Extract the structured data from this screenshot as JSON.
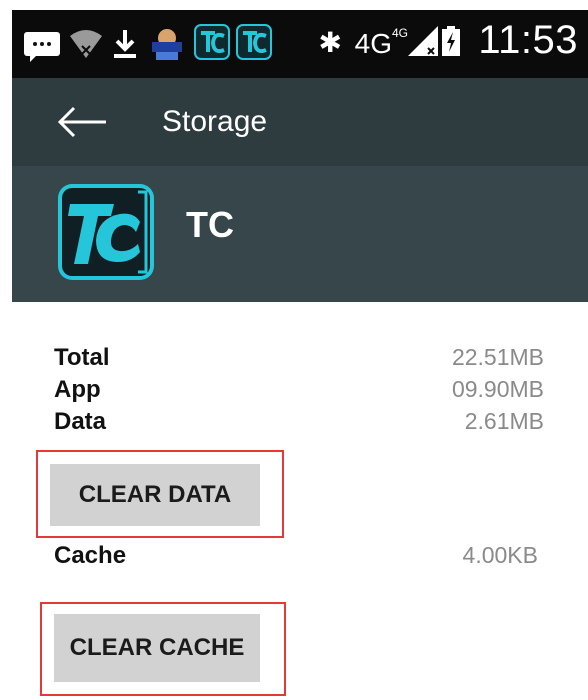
{
  "status_bar": {
    "icons": [
      "message-icon",
      "wifi-icon",
      "download-icon",
      "app-notification-icon",
      "tc-app-icon",
      "tc-app-icon"
    ],
    "bluetooth_icon": "bluetooth-icon",
    "network": "4G",
    "network_small": "4G",
    "signal_icon": "signal-icon",
    "battery_icon": "battery-charging-icon",
    "time": "11:53"
  },
  "toolbar": {
    "back_icon": "back-arrow-icon",
    "title": "Storage"
  },
  "app": {
    "icon": "tc-app-icon",
    "icon_text": "TC",
    "name": "TC",
    "accent_color": "#26c6da"
  },
  "storage": {
    "total_label": "Total",
    "total_value": "22.51MB",
    "app_label": "App",
    "app_value": "09.90MB",
    "data_label": "Data",
    "data_value": "2.61MB",
    "clear_data_label": "CLEAR DATA",
    "cache_label": "Cache",
    "cache_value": "4.00KB",
    "clear_cache_label": "CLEAR CACHE"
  },
  "colors": {
    "status_bar": "#0b0b0b",
    "toolbar": "#2e3b3f",
    "app_header": "#37464a",
    "highlight": "#e53935",
    "button": "#d3d2d2"
  }
}
